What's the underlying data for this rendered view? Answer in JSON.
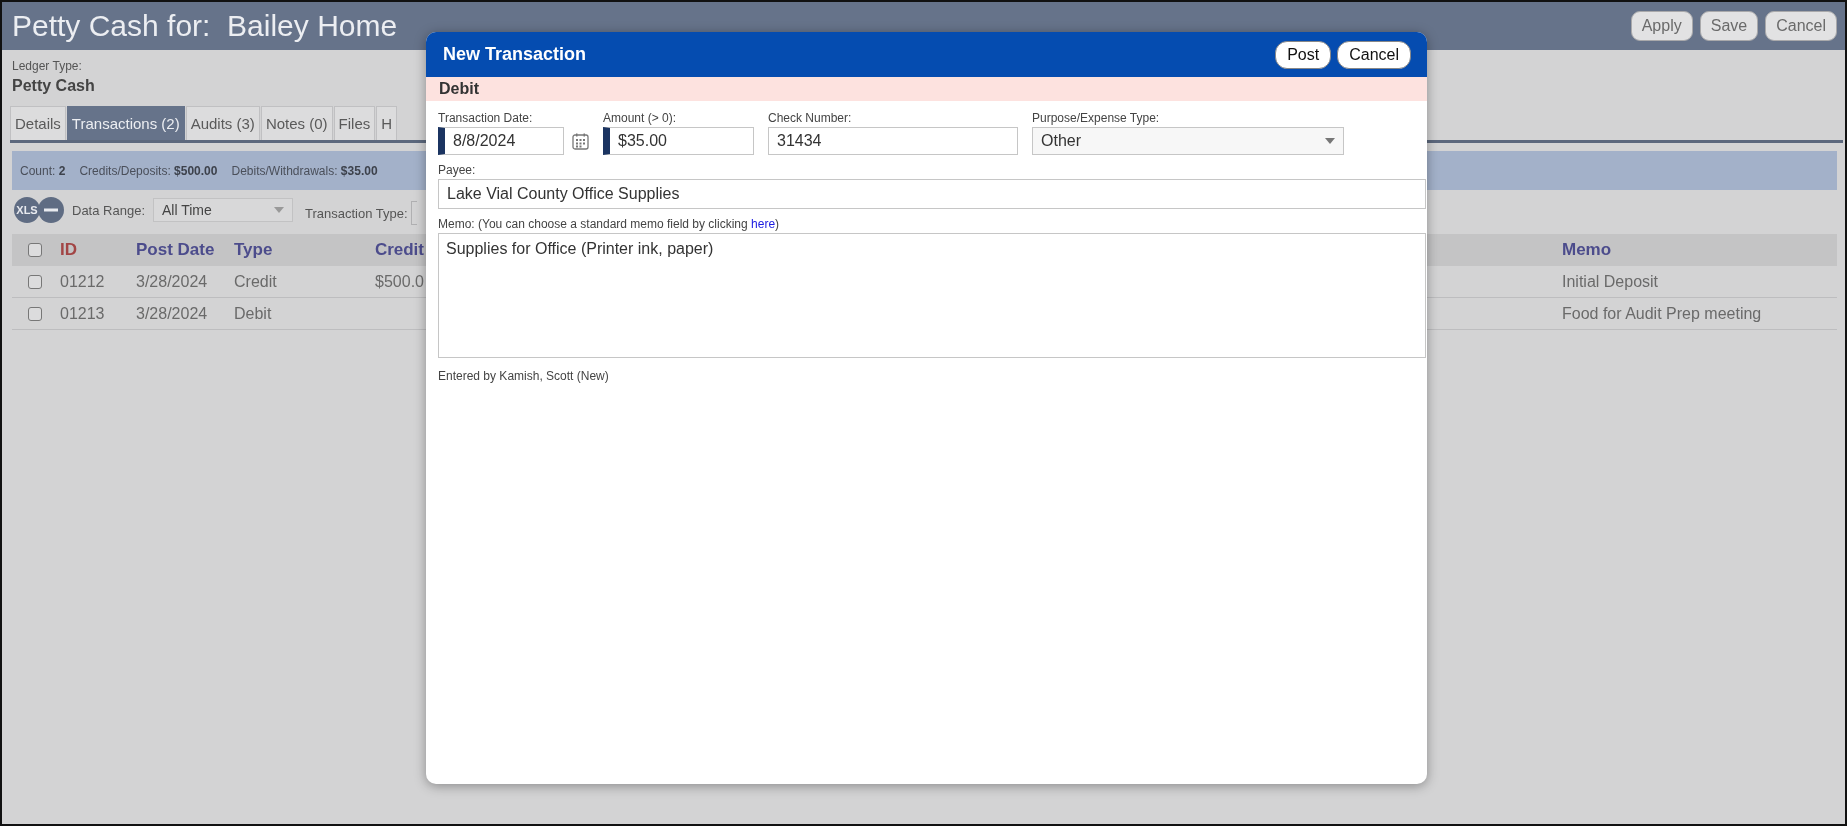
{
  "page": {
    "title": "Petty Cash for:  Bailey Home",
    "buttons": [
      "Apply",
      "Save",
      "Cancel"
    ]
  },
  "ledger": {
    "label": "Ledger Type:",
    "value": "Petty Cash"
  },
  "tabs": [
    {
      "label": "Details",
      "selected": false
    },
    {
      "label": "Transactions (2)",
      "selected": true
    },
    {
      "label": "Audits (3)",
      "selected": false
    },
    {
      "label": "Notes (0)",
      "selected": false
    },
    {
      "label": "Files",
      "selected": false
    },
    {
      "label": "H",
      "selected": false
    }
  ],
  "summary": [
    "Count: **2**",
    "Credits/Deposits: **$500.00**",
    "Debits/Withdrawals: **$35.00**"
  ],
  "filters": {
    "export_button": "XLS",
    "data_range": {
      "label": "Data Range:",
      "value": "All Time"
    },
    "transaction_type": {
      "label": "Transaction Type:"
    }
  },
  "table": {
    "select_all_checked": false,
    "columns": [
      {
        "label": "ID",
        "sorted": true
      },
      {
        "label": "Post Date",
        "sorted": false
      },
      {
        "label": "Type",
        "sorted": false
      },
      {
        "label": "Credit",
        "sorted": false
      },
      {
        "label": "Memo",
        "sorted": false
      }
    ],
    "rows": [
      {
        "checked": false,
        "id": "01212",
        "post_date": "3/28/2024",
        "type": "Credit",
        "credit": "$500.0",
        "memo": "Initial Deposit"
      },
      {
        "checked": false,
        "id": "01213",
        "post_date": "3/28/2024",
        "type": "Debit",
        "memo": "Food for Audit Prep meeting"
      }
    ]
  },
  "modal": {
    "title": "New Transaction",
    "buttons": [
      "Post",
      "Cancel"
    ],
    "entry_type": "Debit",
    "fields": [
      {
        "kind": "date",
        "label": "Transaction Date:",
        "value": "8/8/2024",
        "required": true
      },
      {
        "kind": "text",
        "label": "Amount (> 0):",
        "value": "$35.00",
        "required": true
      },
      {
        "kind": "text",
        "label": "Check Number:",
        "value": "31434",
        "required": false
      },
      {
        "kind": "select",
        "label": "Purpose/Expense Type:",
        "value": "Other",
        "required": false
      }
    ],
    "payee": {
      "label": "Payee:",
      "value": "Lake Vial County Office Supplies"
    },
    "memo": {
      "label": "Memo: (You can choose a standard memo field by clicking ",
      "link": "here",
      "label_end": ")",
      "value": "Supplies for Office (Printer ink, paper)"
    },
    "footer": "Entered by Kamish, Scott (New)"
  }
}
